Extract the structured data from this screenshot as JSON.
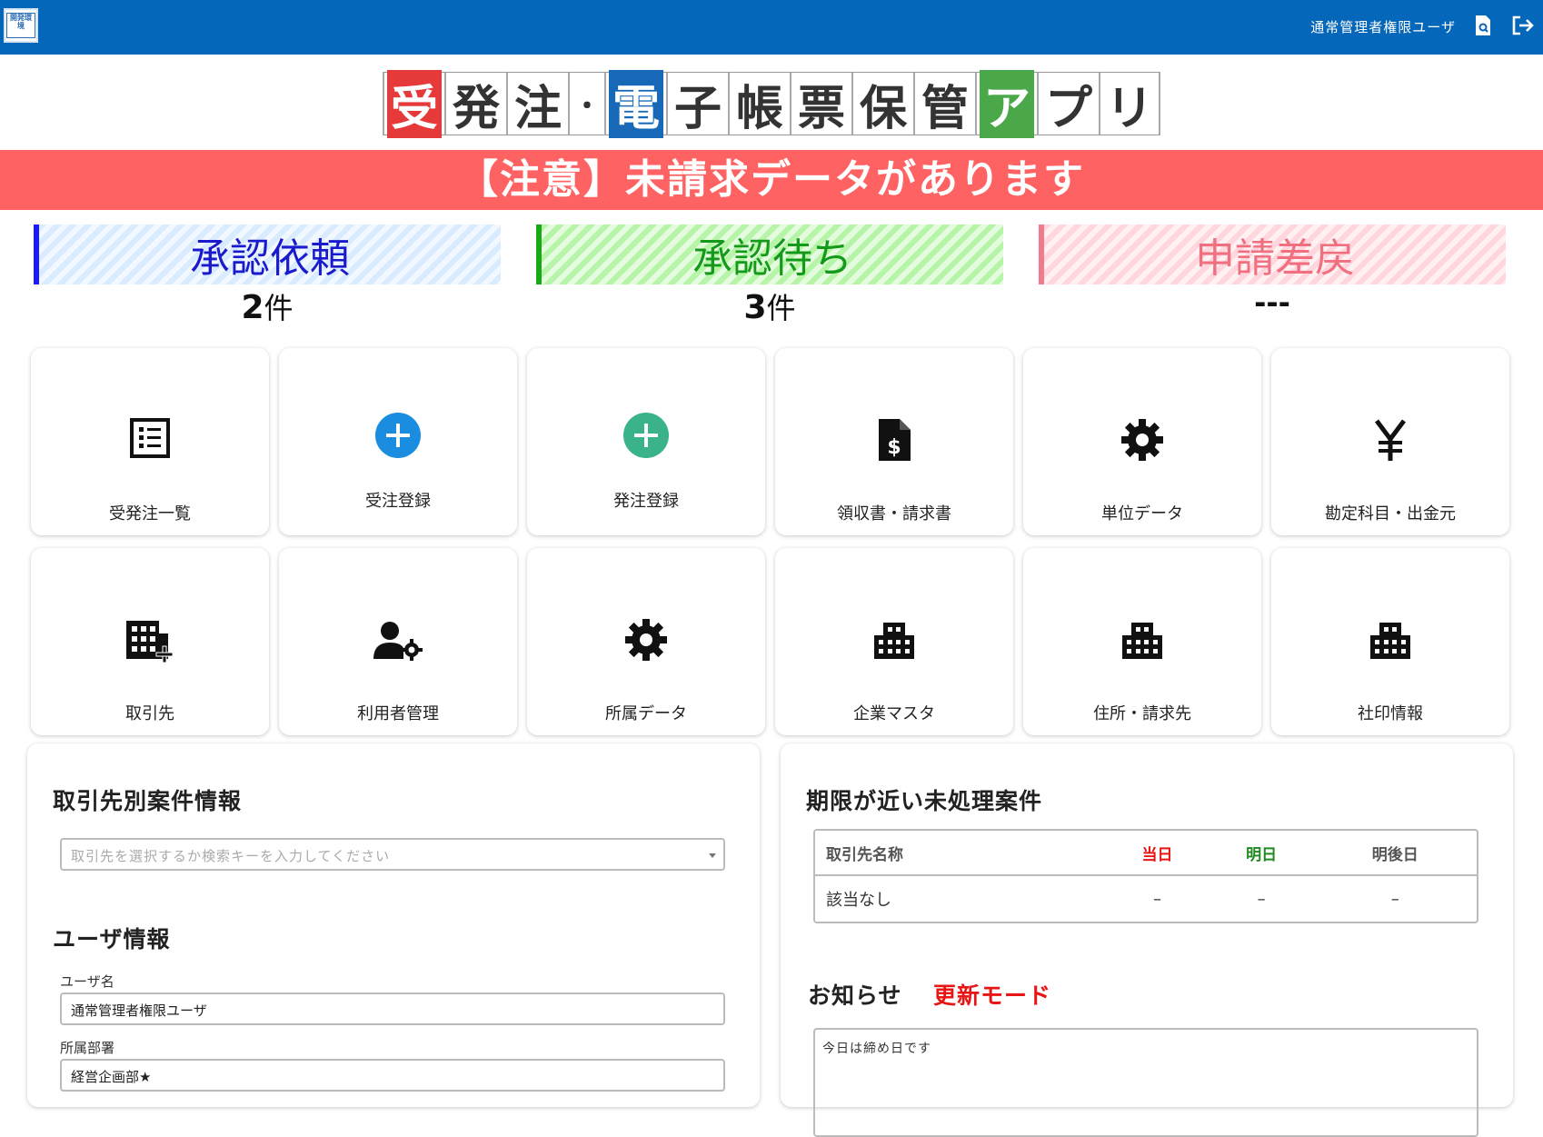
{
  "header": {
    "logo_text": "開発環境",
    "user_name": "通常管理者権限ユーザ"
  },
  "app_title": {
    "chars": [
      "受",
      "発",
      "注",
      "・",
      "電",
      "子",
      "帳",
      "票",
      "保",
      "管",
      "ア",
      "プ",
      "リ"
    ]
  },
  "alert": {
    "text": "【注意】未請求データがあります",
    "color": "#ff6262"
  },
  "status": [
    {
      "label": "承認依頼",
      "count_num": "2",
      "count_unit": "件"
    },
    {
      "label": "承認待ち",
      "count_num": "3",
      "count_unit": "件"
    },
    {
      "label": "申請差戻",
      "count_num": "---",
      "count_unit": ""
    }
  ],
  "tiles": [
    {
      "label": "受発注一覧",
      "icon": "list-icon"
    },
    {
      "label": "受注登録",
      "icon": "plus-circle-blue-icon"
    },
    {
      "label": "発注登録",
      "icon": "plus-circle-green-icon"
    },
    {
      "label": "領収書・請求書",
      "icon": "invoice-dollar-icon"
    },
    {
      "label": "単位データ",
      "icon": "gear-icon"
    },
    {
      "label": "勘定科目・出金元",
      "icon": "yen-icon"
    },
    {
      "label": "取引先",
      "icon": "building-plus-icon"
    },
    {
      "label": "利用者管理",
      "icon": "user-gear-icon"
    },
    {
      "label": "所属データ",
      "icon": "gear-icon"
    },
    {
      "label": "企業マスタ",
      "icon": "building-icon"
    },
    {
      "label": "住所・請求先",
      "icon": "building-icon"
    },
    {
      "label": "社印情報",
      "icon": "building-icon"
    }
  ],
  "left_panel": {
    "title": "取引先別案件情報",
    "select_placeholder": "取引先を選択するか検索キーを入力してください",
    "user_section_title": "ユーザ情報",
    "user_name_label": "ユーザ名",
    "user_name_value": "通常管理者権限ユーザ",
    "department_label": "所属部署",
    "department_value": "経営企画部★"
  },
  "right_panel": {
    "title": "期限が近い未処理案件",
    "table": {
      "headers": [
        "取引先名称",
        "当日",
        "明日",
        "明後日"
      ],
      "header_colors": [
        "#555555",
        "#e81515",
        "#1f8a1f",
        "#555555"
      ],
      "rows": [
        [
          "該当なし",
          "–",
          "–",
          "–"
        ]
      ]
    },
    "notice_title": "お知らせ",
    "update_mode": "更新モード",
    "notice_text": "今日は締め日です"
  }
}
